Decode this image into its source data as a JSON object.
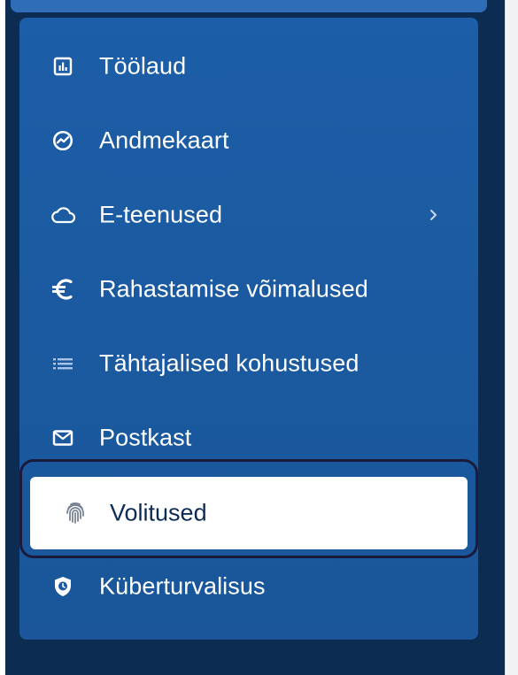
{
  "colors": {
    "page_background": "#0d2c52",
    "menu_panel": "#1c5ea7",
    "active_background": "#ffffff",
    "active_outline": "#1a1a3a",
    "text_on_panel": "#ffffff",
    "text_on_active": "#0d2c52"
  },
  "sidebar": {
    "items": [
      {
        "label": "Töölaud",
        "icon": "dashboard-chart-icon"
      },
      {
        "label": "Andmekaart",
        "icon": "trend-chart-circle-icon"
      },
      {
        "label": "E-teenused",
        "icon": "cloud-icon",
        "has_submenu": true
      },
      {
        "label": "Rahastamise võimalused",
        "icon": "euro-icon"
      },
      {
        "label": "Tähtajalised kohustused",
        "icon": "list-icon"
      },
      {
        "label": "Postkast",
        "icon": "mail-icon"
      },
      {
        "label": "Volitused",
        "icon": "fingerprint-icon",
        "active": true
      },
      {
        "label": "Küberturvalisus",
        "icon": "shield-clock-icon"
      }
    ]
  }
}
